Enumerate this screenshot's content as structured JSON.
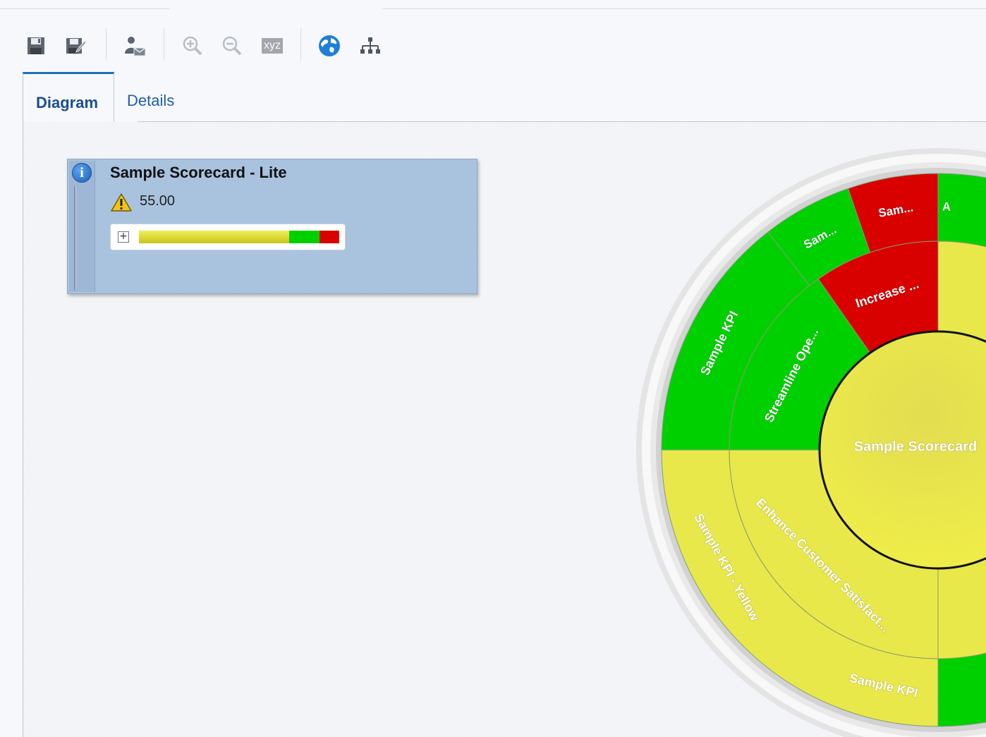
{
  "toolbar": {
    "buttons": [
      {
        "name": "save-button",
        "icon": "floppy-disk-icon",
        "enabled": true
      },
      {
        "name": "save-as-button",
        "icon": "floppy-disk-edit-icon",
        "enabled": true
      },
      {
        "name": "assign-owner-button",
        "icon": "user-envelope-icon",
        "enabled": true
      },
      {
        "name": "zoom-in-button",
        "icon": "zoom-in-icon",
        "enabled": false
      },
      {
        "name": "zoom-out-button",
        "icon": "zoom-out-icon",
        "enabled": false
      },
      {
        "name": "labels-button",
        "icon": "xyz-icon",
        "label": "xyz",
        "enabled": false
      },
      {
        "name": "globe-button",
        "icon": "globe-icon",
        "enabled": true
      },
      {
        "name": "hierarchy-button",
        "icon": "hierarchy-icon",
        "enabled": true
      }
    ]
  },
  "tabs": [
    {
      "label": "Diagram",
      "active": true
    },
    {
      "label": "Details",
      "active": false
    }
  ],
  "scorecard_node": {
    "title": "Sample Scorecard - Lite",
    "score": "55.00",
    "status_icon": "warning-icon",
    "distribution": {
      "yellow": 0.75,
      "green": 0.15,
      "red": 0.1
    }
  },
  "colors": {
    "green": "#00d000",
    "red": "#d90000",
    "yellow": "#e9e84a",
    "accent": "#1f6fc1"
  },
  "sunburst": {
    "center_label": "Sample Scorecard",
    "ring1": [
      {
        "label": "Streamline Ope...",
        "status": "green"
      },
      {
        "label": "Increase ...",
        "status": "red"
      },
      {
        "label": "Enhance Customer Satisfact...",
        "status": "yellow"
      }
    ],
    "ring2": [
      {
        "label": "Sample KPI",
        "status": "green"
      },
      {
        "label": "Sam...",
        "status": "green"
      },
      {
        "label": "Sam...",
        "status": "red"
      },
      {
        "label": "A",
        "status": "green"
      },
      {
        "label": "Sample KPI - Yellow",
        "status": "yellow"
      },
      {
        "label": "Sample KPI",
        "status": "green"
      }
    ]
  }
}
